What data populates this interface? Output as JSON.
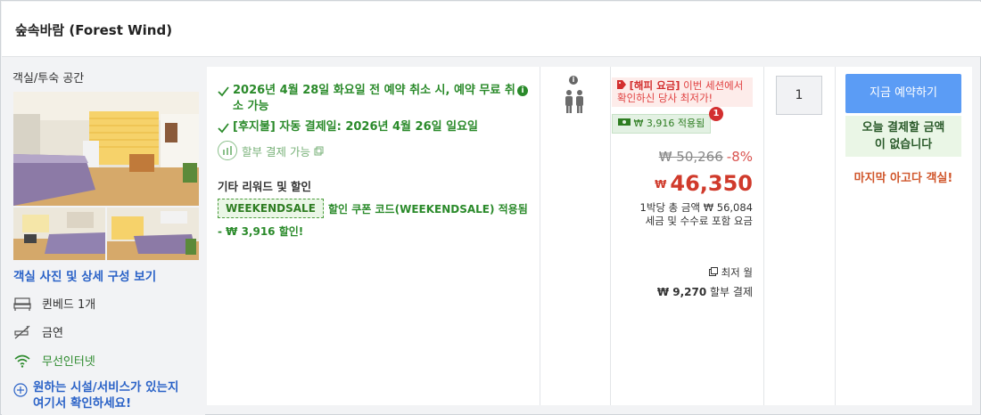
{
  "property": {
    "name": "숲속바람 (Forest Wind)"
  },
  "room": {
    "type": "객실/투숙 공간",
    "photos_link": "객실 사진 및 상세 구성 보기",
    "amenities": [
      {
        "label": "퀸베드 1개",
        "icon": "bed-icon"
      },
      {
        "label": "금연",
        "icon": "no-smoking-icon"
      },
      {
        "label": "무선인터넷",
        "icon": "wifi-icon"
      }
    ],
    "facility_link_line1": "원하는 시설/서비스가 있는지",
    "facility_link_line2": "여기서 확인하세요!"
  },
  "conditions": {
    "cancel": "2026년 4월 28일 화요일 전 예약 취소 시, 예약 무료 취소 가능",
    "autopay": "[후지불] 자동 결제일: 2026년 4월 26일 일요일",
    "installment": "할부 결제 가능",
    "info_icon": "i"
  },
  "rewards": {
    "title": "기타 리워드 및 할인",
    "coupon_code": "WEEKENDSALE",
    "coupon_desc": "할인 쿠폰 코드(WEEKENDSALE) 적용됨",
    "coupon_desc2": "- ₩ 3,916 할인!"
  },
  "occupancy": {
    "info_icon": "i",
    "icon": "two-persons-icon"
  },
  "price": {
    "happy_label": "[해피 요금]",
    "happy_text": " 이번 세션에서 확인하신 당사 최저가!",
    "saved": "₩ 3,916 적용됨",
    "badge": "1",
    "original": "₩ 50,266",
    "discount_pct": "-8%",
    "currency": "₩",
    "final": "46,350",
    "total_line1": "1박당 총 금액 ₩ 56,084",
    "total_line2": "세금 및 수수료 포함 요금",
    "lowest_label": "최저 월",
    "installment_amount": "₩ 9,270",
    "installment_suffix": " 할부 결제"
  },
  "quantity": {
    "value": "1"
  },
  "booking": {
    "button": "지금 예약하기",
    "nopay_line1": "오늘 결제할 금액",
    "nopay_line2": "이 없습니다",
    "last_room": "마지막 아고다 객실!"
  },
  "colors": {
    "accent_green": "#2a8a2a",
    "price_red": "#d03a2b",
    "link_blue": "#2a62c7",
    "book_blue": "#5b9cf5"
  }
}
